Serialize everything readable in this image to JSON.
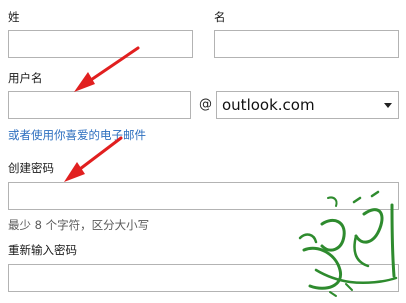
{
  "form": {
    "last_name_label": "姓",
    "first_name_label": "名",
    "last_name_value": "",
    "first_name_value": "",
    "username_label": "用户名",
    "username_value": "",
    "at_symbol": "@",
    "domain_selected": "outlook.com",
    "alt_email_link": "或者使用你喜爱的电子邮件",
    "create_password_label": "创建密码",
    "password_value": "",
    "password_hint": "最少 8 个字符，区分大小写",
    "reenter_password_label": "重新输入密码",
    "reenter_password_value": ""
  },
  "annotations": {
    "arrow_color": "#e11f1f",
    "watermark_color": "#2e8b2e"
  }
}
